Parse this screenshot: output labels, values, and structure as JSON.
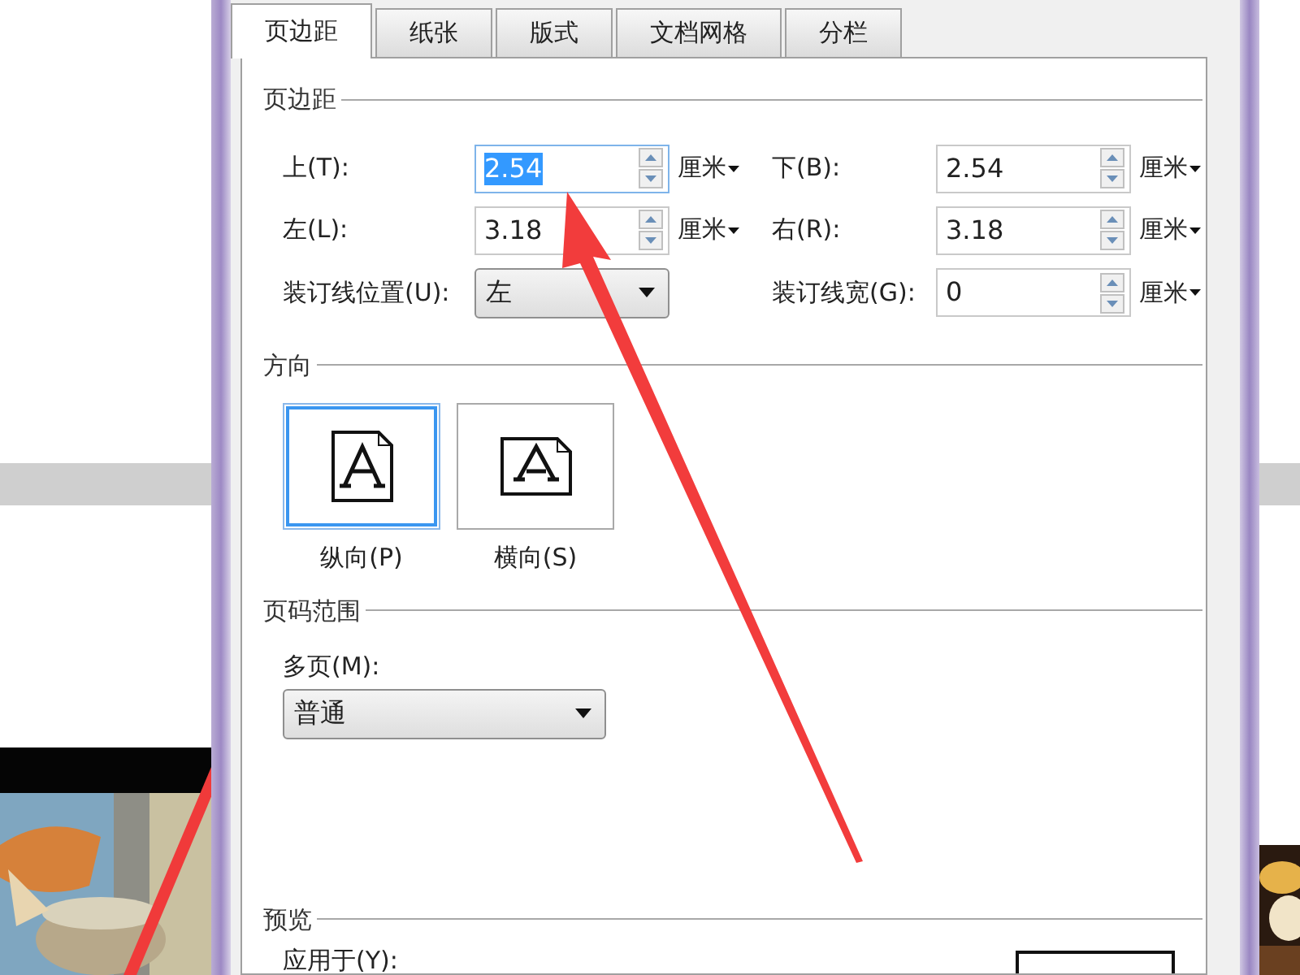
{
  "tabs": [
    {
      "label": "页边距",
      "selected": true
    },
    {
      "label": "纸张",
      "selected": false
    },
    {
      "label": "版式",
      "selected": false
    },
    {
      "label": "文档网格",
      "selected": false
    },
    {
      "label": "分栏",
      "selected": false
    }
  ],
  "margins": {
    "title": "页边距",
    "fields": [
      {
        "kind": "spin",
        "label": "上(T):",
        "value": "2.54",
        "unit": "厘米",
        "focused": true
      },
      {
        "kind": "spin",
        "label": "下(B):",
        "value": "2.54",
        "unit": "厘米",
        "focused": false
      },
      {
        "kind": "spin",
        "label": "左(L):",
        "value": "3.18",
        "unit": "厘米",
        "focused": false
      },
      {
        "kind": "spin",
        "label": "右(R):",
        "value": "3.18",
        "unit": "厘米",
        "focused": false
      },
      {
        "kind": "select",
        "label": "装订线位置(U):",
        "value": "左"
      },
      {
        "kind": "spin",
        "label": "装订线宽(G):",
        "value": "0",
        "unit": "厘米",
        "focused": false
      }
    ]
  },
  "orientation": {
    "title": "方向",
    "options": [
      {
        "label": "纵向(P)",
        "selected": true,
        "kind": "portrait"
      },
      {
        "label": "横向(S)",
        "selected": false,
        "kind": "landscape"
      }
    ]
  },
  "page_range": {
    "title": "页码范围",
    "label": "多页(M):",
    "value": "普通"
  },
  "preview": {
    "title": "预览",
    "apply_label": "应用于(Y):"
  }
}
